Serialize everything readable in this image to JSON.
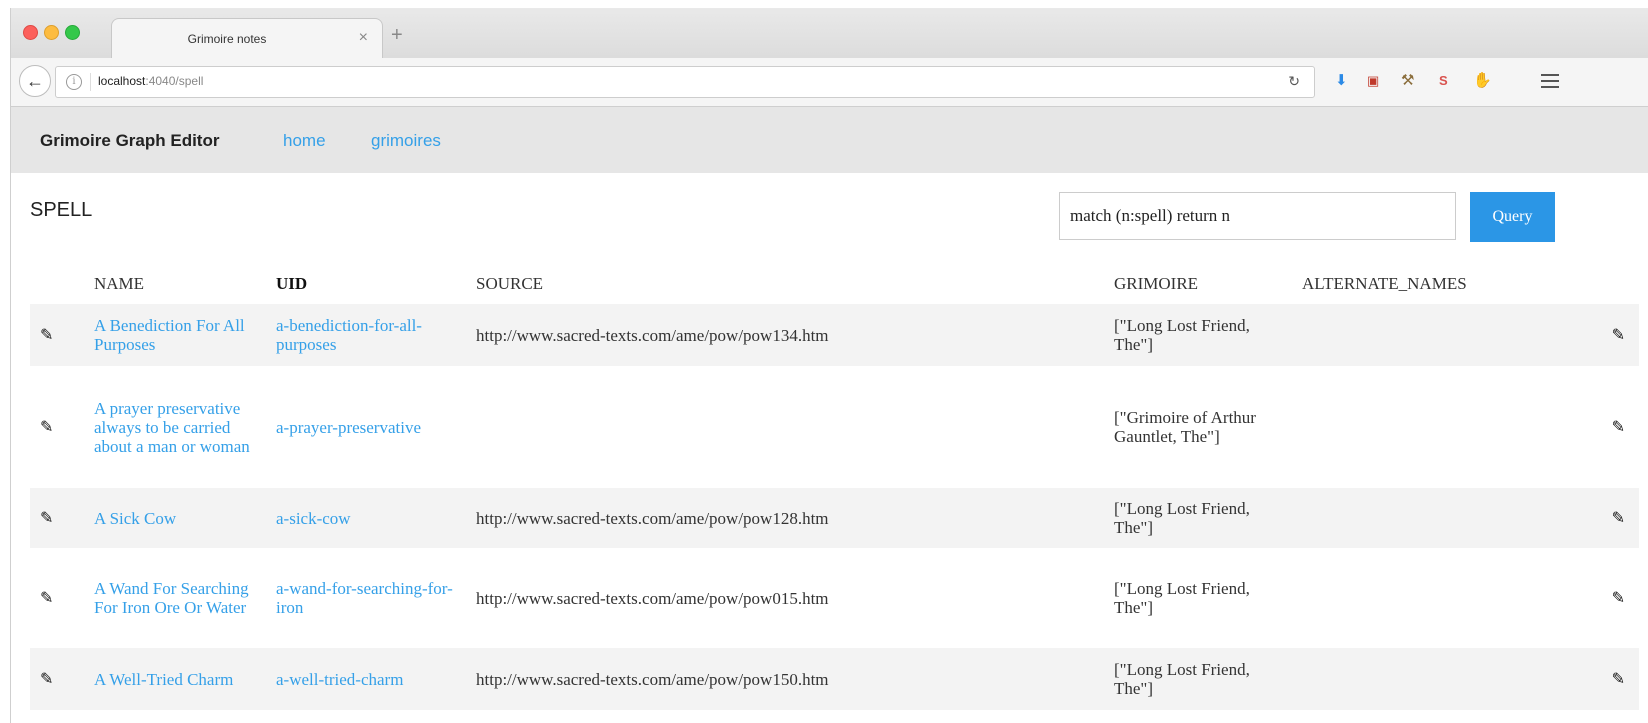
{
  "browser": {
    "tab_title": "Grimoire notes",
    "tab_close": "×",
    "new_tab": "+",
    "url_host": "localhost",
    "url_path": ":4040/spell"
  },
  "app": {
    "brand": "Grimoire Graph Editor",
    "nav": [
      {
        "label": "home"
      },
      {
        "label": "grimoires"
      }
    ]
  },
  "page": {
    "heading": "SPELL",
    "query_value": "match (n:spell) return n",
    "query_button": "Query"
  },
  "table": {
    "columns": [
      "NAME",
      "UID",
      "SOURCE",
      "GRIMOIRE",
      "ALTERNATE_NAMES"
    ],
    "rows": [
      {
        "name": "A Benediction For All Purposes",
        "uid": "a-benediction-for-all-purposes",
        "source": "http://www.sacred-texts.com/ame/pow/pow134.htm",
        "grimoire": "[\"Long Lost Friend, The\"]",
        "alternate_names": ""
      },
      {
        "name": "A prayer preservative always to be carried about a man or woman",
        "uid": "a-prayer-preservative",
        "source": "",
        "grimoire": "[\"Grimoire of Arthur Gauntlet, The\"]",
        "alternate_names": ""
      },
      {
        "name": "A Sick Cow",
        "uid": "a-sick-cow",
        "source": "http://www.sacred-texts.com/ame/pow/pow128.htm",
        "grimoire": "[\"Long Lost Friend, The\"]",
        "alternate_names": ""
      },
      {
        "name": "A Wand For Searching For Iron Ore Or Water",
        "uid": "a-wand-for-searching-for-iron",
        "source": "http://www.sacred-texts.com/ame/pow/pow015.htm",
        "grimoire": "[\"Long Lost Friend, The\"]",
        "alternate_names": ""
      },
      {
        "name": "A Well-Tried Charm",
        "uid": "a-well-tried-charm",
        "source": "http://www.sacred-texts.com/ame/pow/pow150.htm",
        "grimoire": "[\"Long Lost Friend, The\"]",
        "alternate_names": ""
      }
    ]
  },
  "colors": {
    "link": "#35a0e8",
    "query_button": "#2b96e6",
    "header_bar": "#e6e6e6"
  },
  "icons": {
    "edit": "pencil-icon",
    "back": "back-arrow-icon",
    "info": "info-icon",
    "reload": "reload-icon",
    "download": "download-icon",
    "menu": "hamburger-menu-icon"
  }
}
